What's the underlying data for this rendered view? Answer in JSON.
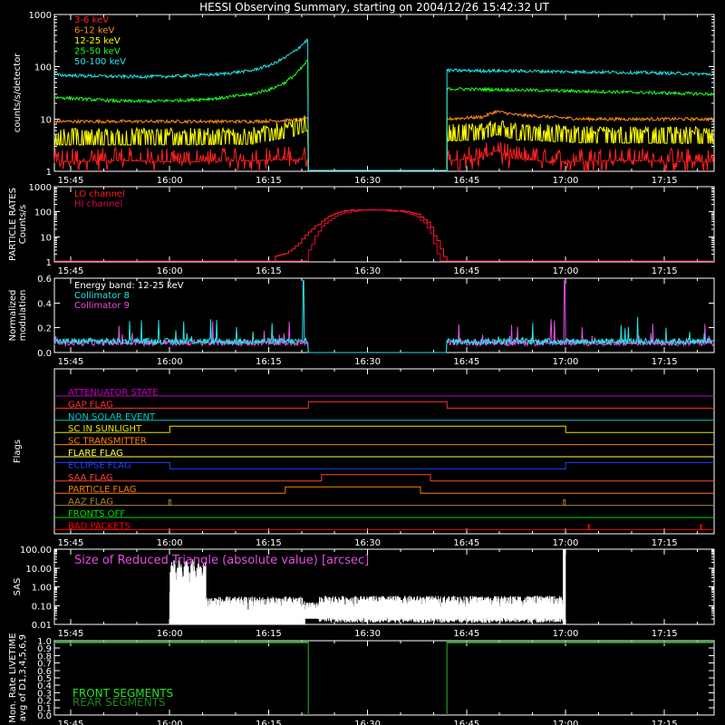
{
  "title": "HESSI Observing Summary, starting on 2004/12/26 15:42:32 UT",
  "time_axis": {
    "start_min": 0,
    "end_min": 100,
    "ticks": [
      {
        "min": 2.47,
        "label": "15:45"
      },
      {
        "min": 17.47,
        "label": "16:00"
      },
      {
        "min": 32.47,
        "label": "16:15"
      },
      {
        "min": 47.47,
        "label": "16:30"
      },
      {
        "min": 62.47,
        "label": "16:45"
      },
      {
        "min": 77.47,
        "label": "17:00"
      },
      {
        "min": 92.47,
        "label": "17:15"
      }
    ]
  },
  "chart_data": [
    {
      "type": "line",
      "panel": "count-rates",
      "ylabel": "counts/s/detector",
      "yscale": "log",
      "ylim": [
        1,
        1000
      ],
      "yticks": [
        "1",
        "10",
        "100",
        "1000"
      ],
      "gap": [
        38.5,
        59.5
      ],
      "series": [
        {
          "name": "3-6 keV",
          "color": "#ff2020",
          "points": [
            [
              0,
              1.5
            ],
            [
              10,
              1.6
            ],
            [
              20,
              1.5
            ],
            [
              30,
              1.6
            ],
            [
              38.4,
              1.7
            ],
            [
              59.6,
              1.6
            ],
            [
              65,
              1.8
            ],
            [
              67,
              2.5
            ],
            [
              69,
              1.8
            ],
            [
              75,
              1.5
            ],
            [
              85,
              1.6
            ],
            [
              100,
              1.5
            ]
          ]
        },
        {
          "name": "6-12 keV",
          "color": "#ff8c1a",
          "points": [
            [
              0,
              9
            ],
            [
              10,
              9
            ],
            [
              20,
              9
            ],
            [
              30,
              9
            ],
            [
              36,
              9.5
            ],
            [
              38.4,
              10
            ],
            [
              59.6,
              10
            ],
            [
              65,
              11
            ],
            [
              67,
              14
            ],
            [
              70,
              12
            ],
            [
              80,
              10
            ],
            [
              100,
              10
            ]
          ]
        },
        {
          "name": "12-25 keV",
          "color": "#ffff00",
          "points": [
            [
              0,
              3.2
            ],
            [
              10,
              3.2
            ],
            [
              20,
              3.2
            ],
            [
              30,
              3.3
            ],
            [
              36,
              4.5
            ],
            [
              38.4,
              6
            ],
            [
              59.6,
              3.8
            ],
            [
              65,
              4
            ],
            [
              67,
              5
            ],
            [
              70,
              4
            ],
            [
              80,
              3.5
            ],
            [
              100,
              3.4
            ]
          ]
        },
        {
          "name": "25-50 keV",
          "color": "#22ff22",
          "points": [
            [
              0,
              26
            ],
            [
              5,
              24
            ],
            [
              10,
              22
            ],
            [
              15,
              22
            ],
            [
              20,
              23
            ],
            [
              25,
              25
            ],
            [
              30,
              30
            ],
            [
              33,
              38
            ],
            [
              35,
              50
            ],
            [
              36.5,
              70
            ],
            [
              37.5,
              95
            ],
            [
              38.4,
              130
            ],
            [
              59.6,
              38
            ],
            [
              70,
              36
            ],
            [
              80,
              34
            ],
            [
              90,
              32
            ],
            [
              100,
              30
            ]
          ]
        },
        {
          "name": "50-100 keV",
          "color": "#22e6e6",
          "points": [
            [
              0,
              70
            ],
            [
              5,
              67
            ],
            [
              10,
              65
            ],
            [
              15,
              65
            ],
            [
              20,
              67
            ],
            [
              25,
              72
            ],
            [
              30,
              85
            ],
            [
              33,
              110
            ],
            [
              35,
              150
            ],
            [
              36.5,
              200
            ],
            [
              37.5,
              260
            ],
            [
              38.4,
              330
            ],
            [
              59.6,
              85
            ],
            [
              70,
              83
            ],
            [
              80,
              80
            ],
            [
              90,
              77
            ],
            [
              100,
              72
            ]
          ]
        }
      ]
    },
    {
      "type": "line",
      "panel": "particle-rates",
      "ylabel": "PARTICLE RATES\nCounts/s",
      "yscale": "log",
      "ylim": [
        1,
        1000
      ],
      "yticks": [
        "1",
        "10",
        "100",
        "1000"
      ],
      "series": [
        {
          "name": "LO channel",
          "color": "#ff2020",
          "points": [
            [
              0,
              1
            ],
            [
              33,
              1
            ],
            [
              33.2,
              1.5
            ],
            [
              35,
              2
            ],
            [
              36,
              3
            ],
            [
              37,
              5
            ],
            [
              38,
              10
            ],
            [
              40,
              30
            ],
            [
              42,
              70
            ],
            [
              44,
              100
            ],
            [
              47,
              110
            ],
            [
              50,
              110
            ],
            [
              53,
              100
            ],
            [
              55,
              70
            ],
            [
              56.5,
              35
            ],
            [
              57.5,
              10
            ],
            [
              58.5,
              3
            ],
            [
              59,
              1.5
            ],
            [
              59.3,
              1
            ],
            [
              100,
              1
            ]
          ]
        },
        {
          "name": "HI channel",
          "color": "#e6004c",
          "points": [
            [
              0,
              1
            ],
            [
              38,
              1
            ],
            [
              38.3,
              2
            ],
            [
              39,
              5
            ],
            [
              40,
              15
            ],
            [
              42,
              50
            ],
            [
              44,
              90
            ],
            [
              47,
              105
            ],
            [
              50,
              105
            ],
            [
              53,
              90
            ],
            [
              55,
              55
            ],
            [
              56.5,
              20
            ],
            [
              57.5,
              5
            ],
            [
              58,
              2
            ],
            [
              58.3,
              1
            ],
            [
              100,
              1
            ]
          ]
        }
      ]
    },
    {
      "type": "line",
      "panel": "modulation",
      "ylabel": "Normalized\nmodulation",
      "ylim": [
        0,
        0.6
      ],
      "yticks": [
        "0.0",
        "0.2",
        "0.4",
        "0.6"
      ],
      "annotation": "Energy band: 12-25 keV",
      "series": [
        {
          "name": "Collimator 8",
          "color": "#22e6e6",
          "base": 0.09
        },
        {
          "name": "Collimator 9",
          "color": "#e64ce6",
          "base": 0.08
        }
      ]
    },
    {
      "type": "line",
      "panel": "flags",
      "ylabel": "Flags",
      "series": [
        {
          "name": "ATTENUATOR STATE",
          "color": "#c000c0",
          "transitions": []
        },
        {
          "name": "GAP FLAG",
          "color": "#ff3030",
          "transitions": [
            [
              38.5,
              1
            ],
            [
              59.5,
              0
            ]
          ]
        },
        {
          "name": "NON SOLAR EVENT",
          "color": "#00c8c8",
          "transitions": []
        },
        {
          "name": "SC IN SUNLIGHT",
          "color": "#e6e600",
          "transitions": [
            [
              17.5,
              1
            ],
            [
              77.5,
              0
            ]
          ]
        },
        {
          "name": "SC TRANSMITTER",
          "color": "#ff8000",
          "transitions": []
        },
        {
          "name": "FLARE FLAG",
          "color": "#ffff40",
          "transitions": []
        },
        {
          "name": "ECLIPSE FLAG",
          "color": "#2040ff",
          "transitions": [
            [
              17.5,
              0
            ],
            [
              77.5,
              1
            ]
          ],
          "initial": 1
        },
        {
          "name": "SAA FLAG",
          "color": "#ff4040",
          "transitions": [
            [
              40.5,
              1
            ],
            [
              57.0,
              0
            ]
          ]
        },
        {
          "name": "PARTICLE FLAG",
          "color": "#ff8000",
          "transitions": [
            [
              35.0,
              1
            ],
            [
              55.5,
              0
            ]
          ]
        },
        {
          "name": "AAZ FLAG",
          "color": "#b08030",
          "transitions": []
        },
        {
          "name": "FRONTS OFF",
          "color": "#00e000",
          "transitions": []
        },
        {
          "name": "BAD PACKETS",
          "color": "#ff0000",
          "transitions": []
        }
      ]
    },
    {
      "type": "line",
      "panel": "sas",
      "ylabel": "SAS",
      "yscale": "log",
      "ylim": [
        0.01,
        100
      ],
      "yticks": [
        "0.01",
        "0.10",
        "1.00",
        "10.00",
        "100.00"
      ],
      "annotation": "Size of Reduced Triangle (absolute value) [arcsec]",
      "series": [
        {
          "name": "SAS",
          "color": "#ffffff",
          "range": [
            17.5,
            77.5
          ]
        }
      ]
    },
    {
      "type": "line",
      "panel": "livetime",
      "ylabel": "Mon. Rate LIVETIME\navg of D1,3,4,5,6,9",
      "ylim": [
        0,
        1
      ],
      "yticks": [
        "0.0",
        "0.1",
        "0.2",
        "0.3",
        "0.4",
        "0.5",
        "0.6",
        "0.7",
        "0.8",
        "0.9",
        "1.0"
      ],
      "gap": [
        38.5,
        59.5
      ],
      "series": [
        {
          "name": "FRONT SEGMENTS",
          "color": "#22e622",
          "level": 0.98
        },
        {
          "name": "REAR SEGMENTS",
          "color": "#208020",
          "level": 0.97
        }
      ]
    }
  ]
}
